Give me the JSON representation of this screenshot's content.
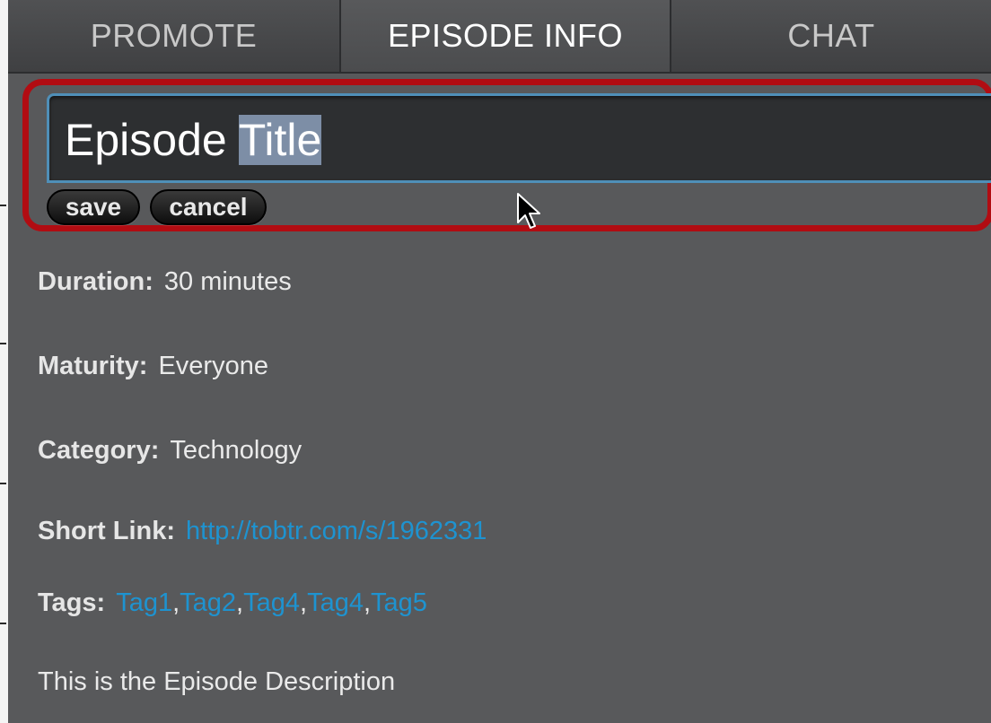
{
  "tabs": [
    {
      "label": "PROMOTE",
      "active": false
    },
    {
      "label": "EPISODE INFO",
      "active": true
    },
    {
      "label": "CHAT",
      "active": false
    }
  ],
  "editor": {
    "title_prefix": "Episode ",
    "title_selected": "Title",
    "save_label": "save",
    "cancel_label": "cancel"
  },
  "info": {
    "duration_label": "Duration:",
    "duration_value": "30 minutes",
    "maturity_label": "Maturity:",
    "maturity_value": "Everyone",
    "category_label": "Category:",
    "category_value": "Technology",
    "short_link_label": "Short Link:",
    "short_link_value": "http://tobtr.com/s/1962331",
    "tags_label": "Tags:",
    "tags": [
      "Tag1",
      "Tag2",
      "Tag4",
      "Tag4",
      "Tag5"
    ],
    "tag_separator": ",",
    "description": "This is the Episode Description"
  },
  "colors": {
    "highlight_border": "#b10c12",
    "link": "#1e93d0",
    "panel_bg": "#58595b",
    "input_border": "#4f8fb8",
    "selection": "#7d8ea6"
  },
  "icons": [
    "mouse-pointer-icon",
    "resize-grip-icon"
  ]
}
